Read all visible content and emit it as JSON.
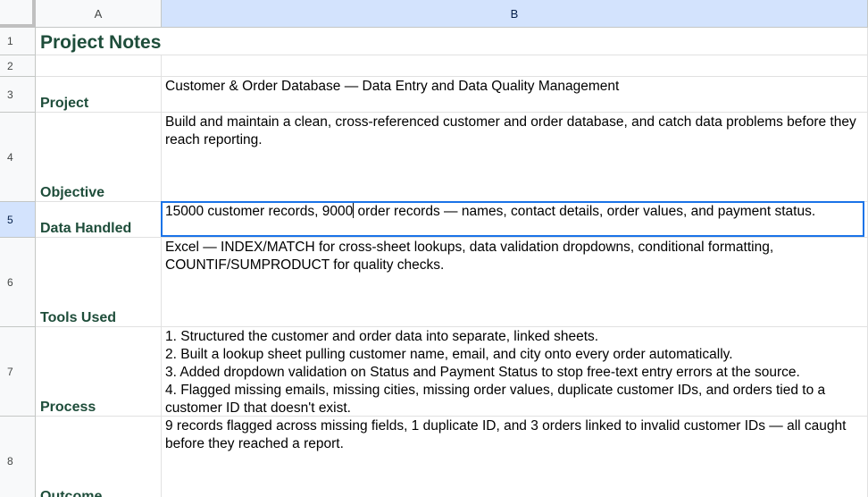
{
  "columns": {
    "a": "A",
    "b": "B"
  },
  "rows": {
    "r1": "1",
    "r2": "2",
    "r3": "3",
    "r4": "4",
    "r5": "5",
    "r6": "6",
    "r7": "7",
    "r8": "8"
  },
  "title": "Project Notes",
  "labels": {
    "project": "Project",
    "objective": "Objective",
    "data_handled": "Data Handled",
    "tools_used": "Tools Used",
    "process": "Process",
    "outcome": "Outcome"
  },
  "values": {
    "project": "Customer & Order Database — Data Entry and Data Quality Management",
    "objective": "Build and maintain a clean, cross-referenced customer and order database, and catch data problems before they reach reporting.",
    "data_handled_before_cursor": "15000 customer records, 9000",
    "data_handled_after_cursor": " order records — names, contact details, order values, and payment status.",
    "tools_used": "Excel — INDEX/MATCH for cross-sheet lookups, data validation dropdowns, conditional formatting, COUNTIF/SUMPRODUCT for quality checks.",
    "process": "1. Structured the customer and order data into separate, linked sheets.\n2. Built a lookup sheet pulling customer name, email, and city onto every order automatically.\n3. Added dropdown validation on Status and Payment Status to stop free-text entry errors at the source.\n4. Flagged missing emails, missing cities, missing order values, duplicate customer IDs, and orders tied to a customer ID that doesn't exist.",
    "outcome": "9 records flagged across missing fields, 1 duplicate ID, and 3 orders linked to invalid customer IDs — all caught before they reached a report."
  }
}
